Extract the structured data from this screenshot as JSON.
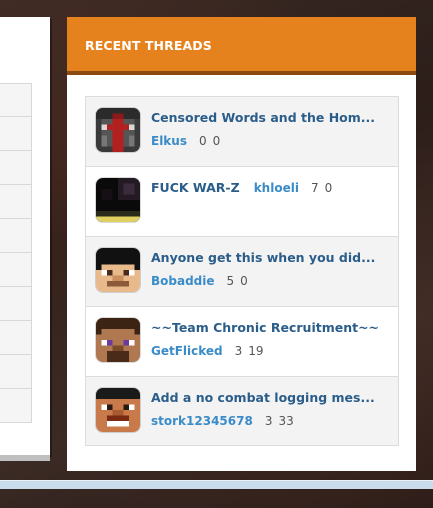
{
  "widget": {
    "title": "RECENT THREADS",
    "threads": [
      {
        "title": "Censored Words and the Hom...",
        "author": "Elkus",
        "replies": "0",
        "views": "0"
      },
      {
        "title": "FUCK WAR-Z",
        "author": "khloeli",
        "replies": "7",
        "views": "0"
      },
      {
        "title": "Anyone get this when you did...",
        "author": "Bobaddie",
        "replies": "5",
        "views": "0"
      },
      {
        "title": "~~Team Chronic Recruitment~~",
        "author": "GetFlicked",
        "replies": "3",
        "views": "19"
      },
      {
        "title": "Add a no combat logging mes...",
        "author": "stork12345678",
        "replies": "3",
        "views": "33"
      }
    ]
  },
  "colors": {
    "header": "#e6821e",
    "thread_title": "#2a5d8a",
    "author": "#3a8cc8"
  }
}
